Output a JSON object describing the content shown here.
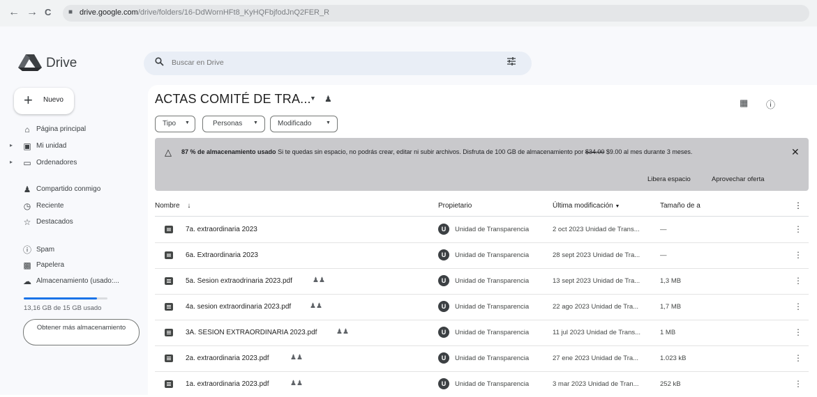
{
  "browser": {
    "back": "←",
    "forward": "→",
    "reload": "C",
    "url_host": "drive.google.com",
    "url_path": "/drive/folders/16-DdWornHFt8_KyHQFbjfodJnQ2FER_R"
  },
  "app": {
    "name": "Drive"
  },
  "search": {
    "placeholder": "Buscar en Drive"
  },
  "sidebar": {
    "new_label": "Nuevo",
    "items": [
      {
        "label": "Página principal",
        "icon": "home-icon"
      },
      {
        "label": "Mi unidad",
        "icon": "my-drive-icon"
      },
      {
        "label": "Ordenadores",
        "icon": "computer-icon"
      },
      {
        "label": "Compartido conmigo",
        "icon": "shared-icon"
      },
      {
        "label": "Reciente",
        "icon": "clock-icon"
      },
      {
        "label": "Destacados",
        "icon": "star-icon"
      },
      {
        "label": "Spam",
        "icon": "spam-icon"
      },
      {
        "label": "Papelera",
        "icon": "trash-icon"
      },
      {
        "label": "Almacenamiento (usado:...",
        "icon": "cloud-icon"
      }
    ],
    "storage_text": "13,16 GB de 15 GB usado",
    "storage_fraction": 0.877,
    "get_storage": "Obtener más almacenamiento"
  },
  "folder": {
    "title": "ACTAS COMITÉ DE TRA..."
  },
  "filters": {
    "type": "Tipo",
    "people": "Personas",
    "modified": "Modificado"
  },
  "banner": {
    "bold": "87 % de almacenamiento usado",
    "text": " Si te quedas sin espacio, no podrás crear, editar ni subir archivos. Disfruta de 100 GB de almacenamiento por ",
    "old_price": "$34.00",
    "text2": " $9.00 al mes durante 3 meses.",
    "free_space": "Libera espacio",
    "claim_offer": "Aprovechar oferta"
  },
  "table": {
    "headers": {
      "name": "Nombre",
      "owner": "Propietario",
      "modified": "Última modificación",
      "size": "Tamaño de a"
    },
    "rows": [
      {
        "name": "7a. extraordinaria 2023",
        "type": "folder",
        "shared": false,
        "owner": "Unidad de Transparencia",
        "modified": "2 oct 2023 Unidad de Trans...",
        "size": "—"
      },
      {
        "name": "6a. Extraordinaria 2023",
        "type": "folder",
        "shared": false,
        "owner": "Unidad de Transparencia",
        "modified": "28 sept 2023 Unidad de Tra...",
        "size": "—"
      },
      {
        "name": "5a. Sesion extraodrinaria 2023.pdf",
        "type": "pdf",
        "shared": true,
        "owner": "Unidad de Transparencia",
        "modified": "13 sept 2023 Unidad de Tra...",
        "size": "1,3 MB"
      },
      {
        "name": "4a. sesion extraordinaria 2023.pdf",
        "type": "pdf",
        "shared": true,
        "owner": "Unidad de Transparencia",
        "modified": "22 ago 2023 Unidad de Tra...",
        "size": "1,7 MB"
      },
      {
        "name": "3A. SESION EXTRAORDINARIA 2023.pdf",
        "type": "pdf",
        "shared": true,
        "owner": "Unidad de Transparencia",
        "modified": "11 jul 2023 Unidad de Trans...",
        "size": "1 MB"
      },
      {
        "name": "2a. extraordinaria 2023.pdf",
        "type": "pdf",
        "shared": true,
        "owner": "Unidad de Transparencia",
        "modified": "27 ene 2023 Unidad de Tra...",
        "size": "1.023 kB"
      },
      {
        "name": "1a. extraordinaria 2023.pdf",
        "type": "pdf",
        "shared": true,
        "owner": "Unidad de Transparencia",
        "modified": "3 mar 2023 Unidad de Tran...",
        "size": "252 kB"
      }
    ]
  }
}
